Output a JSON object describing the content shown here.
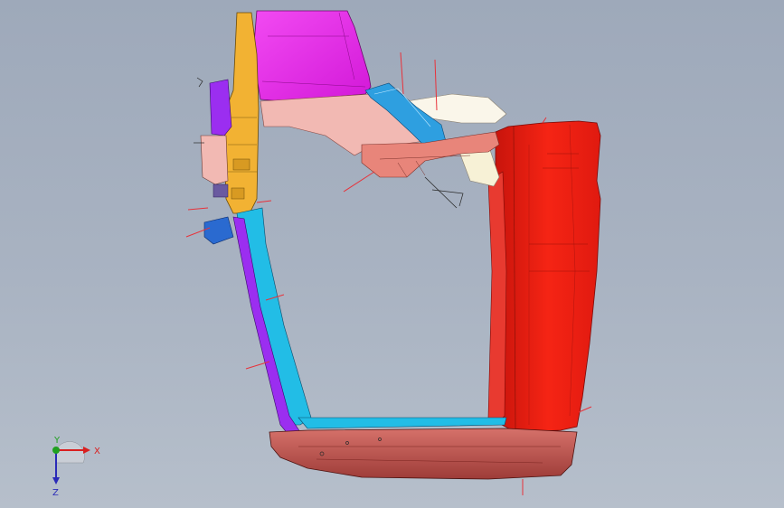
{
  "viewport": {
    "background_top": "#9ea9ba",
    "background_bottom": "#b6bfcb"
  },
  "model": {
    "colors": {
      "magenta_panel": "#ee22ee",
      "yellow_pillar": "#f2b233",
      "cyan_rail": "#22bde6",
      "blue_rail": "#2e9fe0",
      "pink_panel": "#f2b9b3",
      "salmon_panel": "#e8857a",
      "red_door": "#f21d10",
      "maroon_sill": "#c24f4a",
      "purple_rail": "#9b2ef0",
      "cream_panel": "#f7f1d6",
      "red_lines": "#e8323a"
    }
  },
  "triad": {
    "x_label": "X",
    "y_label": "Y",
    "z_label": "Z",
    "x_color": "#d92020",
    "y_color": "#20a020",
    "z_color": "#2a2ab8"
  }
}
